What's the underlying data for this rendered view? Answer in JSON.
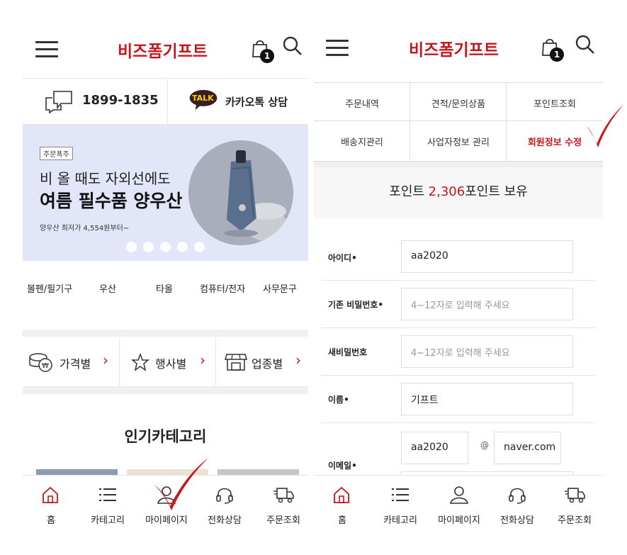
{
  "common": {
    "logo": "비즈폼기프트",
    "cart_count": "1",
    "nav": [
      {
        "label": "홈",
        "icon": "home-icon"
      },
      {
        "label": "카테고리",
        "icon": "list-icon"
      },
      {
        "label": "마이페이지",
        "icon": "user-icon"
      },
      {
        "label": "전화상담",
        "icon": "headset-icon"
      },
      {
        "label": "주문조회",
        "icon": "delivery-truck-icon"
      }
    ]
  },
  "left": {
    "phone": "1899-1835",
    "talk_badge": "TALK",
    "talk_label": "카카오톡 상담",
    "banner": {
      "tag": "주문폭주",
      "sub": "비 올 때도 자외선에도",
      "title": "여름 필수품 양우산",
      "price": "양우산 최저가 4,554원부터~"
    },
    "categories": [
      "볼펜/필기구",
      "우산",
      "타올",
      "컴퓨터/전자",
      "사무문구"
    ],
    "filters": [
      {
        "label": "가격별",
        "icon": "coin-icon"
      },
      {
        "label": "행사별",
        "icon": "star-icon"
      },
      {
        "label": "업종별",
        "icon": "store-icon"
      }
    ],
    "popular_title": "인기카테고리"
  },
  "right": {
    "tabs": [
      "주문내역",
      "견적/문의상품",
      "포인트조회",
      "배송지관리",
      "사업자정보 관리",
      "회원정보 수정"
    ],
    "points": {
      "prefix": "포인트 ",
      "value": "2,306",
      "suffix": "포인트 보유"
    },
    "form": {
      "id_label": "아이디•",
      "id_value": "aa2020",
      "cur_pw_label": "기존 비밀번호•",
      "cur_pw_placeholder": "4~12자로 입력해 주세요",
      "new_pw_label": "새비밀번호",
      "new_pw_placeholder": "4~12자로 입력해 주세요",
      "name_label": "이름•",
      "name_value": "기프트",
      "email_label": "이메일•",
      "email_user": "aa2020",
      "email_at": "@",
      "email_domain": "naver.com"
    }
  },
  "colors": {
    "accent": "#c8161d",
    "banner_bg": "#e3e6f8",
    "kakao": "#3c1e1e"
  }
}
